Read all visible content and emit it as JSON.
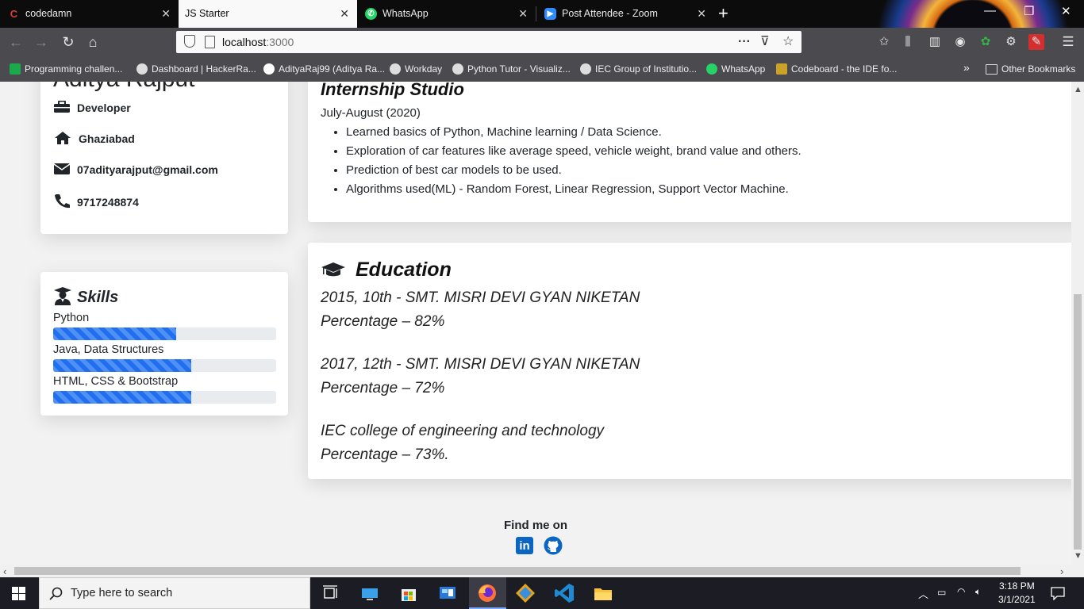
{
  "browser": {
    "tabs": [
      {
        "label": "codedamn",
        "active": false
      },
      {
        "label": "JS Starter",
        "active": true
      },
      {
        "label": "WhatsApp",
        "active": false
      },
      {
        "label": "Post Attendee - Zoom",
        "active": false
      }
    ],
    "url_host": "localhost",
    "url_port": ":3000",
    "bookmarks": [
      "Programming challen...",
      "Dashboard | HackerRa...",
      "AdityaRaj99 (Aditya Ra...",
      "Workday",
      "Python Tutor - Visualiz...",
      "IEC Group of Institutio...",
      "WhatsApp",
      "Codeboard - the IDE fo..."
    ],
    "other_bookmarks": "Other Bookmarks"
  },
  "profile": {
    "name": "Aditya Rajput",
    "role": "Developer",
    "city": "Ghaziabad",
    "email": "07adityarajput@gmail.com",
    "phone": "9717248874"
  },
  "skills": {
    "title": "Skills",
    "items": [
      {
        "label": "Python",
        "level": 0.55
      },
      {
        "label": "Java, Data Structures",
        "level": 0.62
      },
      {
        "label": "HTML, CSS & Bootstrap",
        "level": 0.62
      }
    ]
  },
  "internship": {
    "title": "Internship Studio",
    "period": "July-August (2020)",
    "points": [
      "Learned basics of Python, Machine learning / Data Science.",
      "Exploration of car features like average speed, vehicle weight, brand value and others.",
      "Prediction of best car models to be used.",
      "Algorithms used(ML) - Random Forest, Linear Regression, Support Vector Machine."
    ]
  },
  "education": {
    "title": "Education",
    "entries": [
      {
        "line1": "2015, 10th - SMT. MISRI DEVI GYAN NIKETAN",
        "line2": "Percentage – 82%"
      },
      {
        "line1": "2017, 12th - SMT. MISRI DEVI GYAN NIKETAN",
        "line2": "Percentage – 72%"
      },
      {
        "line1": "IEC college of engineering and technology",
        "line2": "Percentage – 73%."
      }
    ]
  },
  "footer": {
    "find_me": "Find me on",
    "linkedin_text": "in"
  },
  "taskbar": {
    "search_placeholder": "Type here to search",
    "time": "3:18 PM",
    "date": "3/1/2021"
  },
  "colors": {
    "progress": "#1f6ff0",
    "linkedin": "#0a66c2",
    "github": "#0a66c2",
    "browser_dark": "#0c0c0d",
    "toolbar": "#4a4a4f"
  }
}
